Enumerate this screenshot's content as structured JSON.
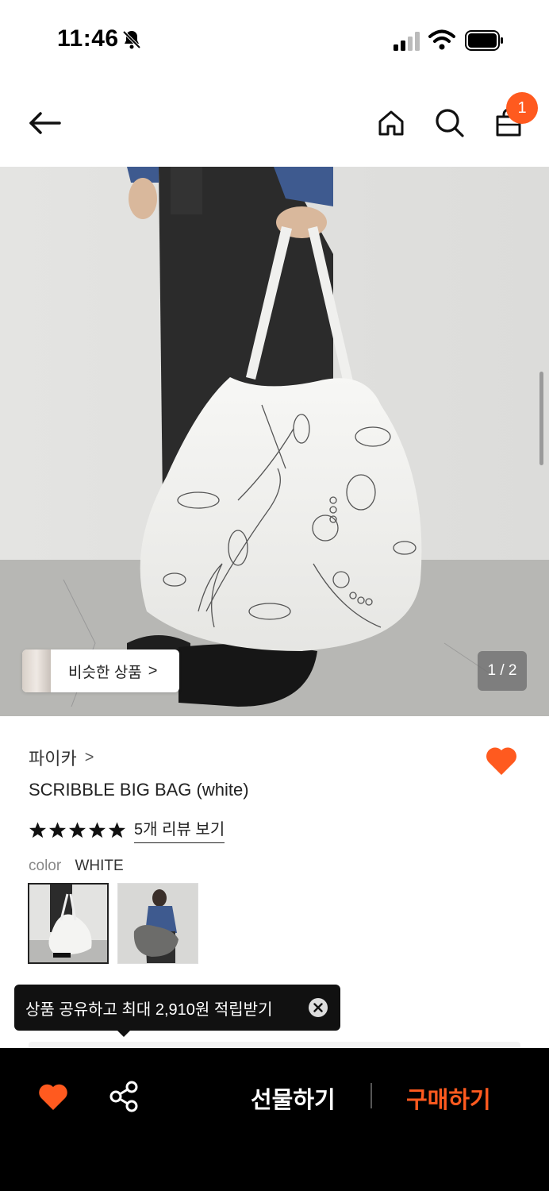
{
  "status_bar": {
    "time": "11:46",
    "icons": [
      "bell-slash-icon",
      "signal-icon",
      "wifi-icon",
      "battery-icon"
    ]
  },
  "header": {
    "back": "arrow-left-icon",
    "home": "home-icon",
    "search": "search-icon",
    "cart": "shopping-bag-icon",
    "cart_count": "1"
  },
  "hero": {
    "similar_label": "비슷한 상품",
    "similar_chevron": ">",
    "page_indicator": "1 / 2"
  },
  "product": {
    "brand": "파이카",
    "brand_chevron": ">",
    "name": "SCRIBBLE BIG BAG (white)",
    "rating_stars": 5,
    "review_link": "5개 리뷰 보기",
    "color_label": "color",
    "color_value": "WHITE",
    "swatches": [
      "white",
      "gray"
    ],
    "wished": true
  },
  "tooltip": {
    "text": "상품 공유하고 최대 2,910원 적립받기"
  },
  "bottom_bar": {
    "gift_label": "선물하기",
    "buy_label": "구매하기"
  },
  "colors": {
    "accent": "#ff5a1f",
    "bottom_bar": "#000000",
    "tooltip": "#111111"
  }
}
